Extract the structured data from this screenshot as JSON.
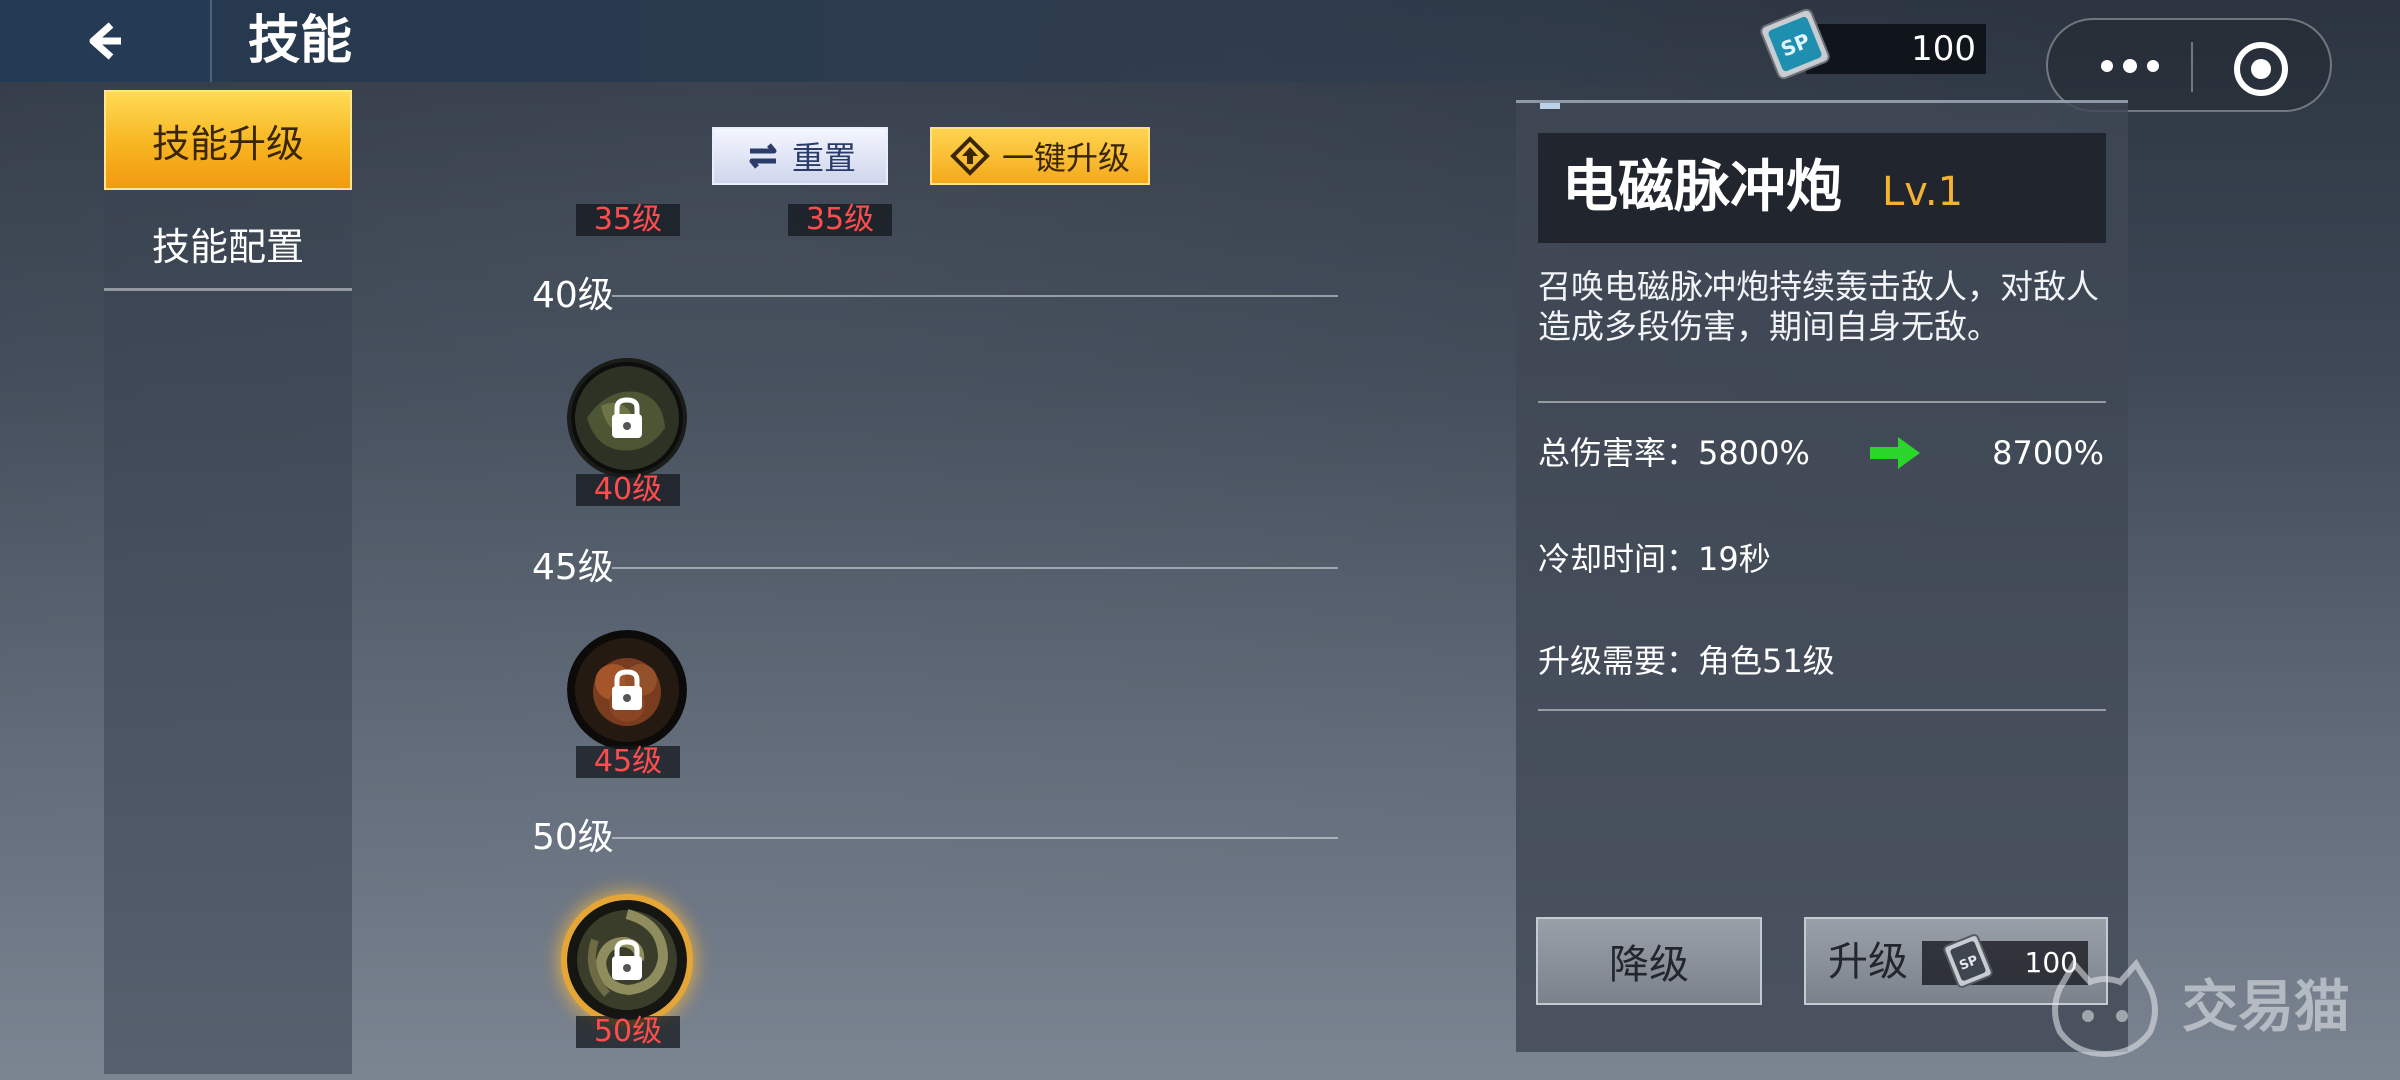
{
  "header": {
    "title": "技能",
    "currency_amount": "100",
    "currency_icon_text": "SP"
  },
  "sidebar": {
    "items": [
      {
        "label": "技能升级",
        "active": true
      },
      {
        "label": "技能配置",
        "active": false
      }
    ]
  },
  "actions": {
    "reset_label": "重置",
    "upgrade_all_label": "一键升级"
  },
  "skill_tree": {
    "top_tags": [
      "35级",
      "35级"
    ],
    "tiers": [
      {
        "label": "40级",
        "node_label": "40级",
        "locked": true,
        "highlighted": false
      },
      {
        "label": "45级",
        "node_label": "45级",
        "locked": true,
        "highlighted": false
      },
      {
        "label": "50级",
        "node_label": "50级",
        "locked": true,
        "highlighted": true
      }
    ]
  },
  "detail": {
    "skill_name": "电磁脉冲炮",
    "level": "Lv.1",
    "description": "召唤电磁脉冲炮持续轰击敌人，对敌人造成多段伤害，期间自身无敌。",
    "stats": {
      "damage_label": "总伤害率：",
      "damage_current": "5800%",
      "damage_next": "8700%",
      "cooldown_label": "冷却时间：",
      "cooldown_value": "19秒",
      "requirement_label": "升级需要：",
      "requirement_value": "角色51级"
    },
    "downgrade_label": "降级",
    "upgrade_label": "升级",
    "upgrade_cost": "100"
  },
  "watermark": {
    "text": "交易猫"
  },
  "colors": {
    "accent_gold": "#f7b521",
    "level_red": "#ff4d4d",
    "level_text": "#f2b233",
    "arrow_green": "#2bd62b"
  }
}
